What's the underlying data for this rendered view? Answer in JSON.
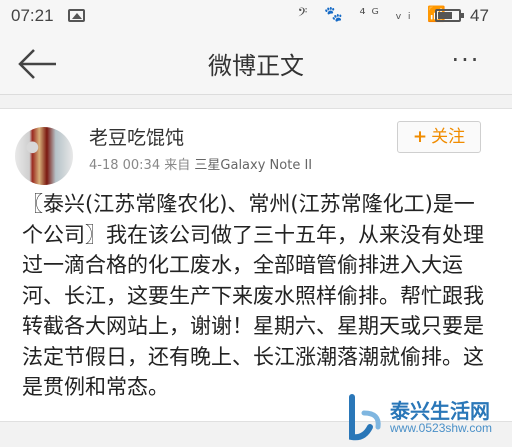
{
  "status_bar": {
    "time": "07:21",
    "right_icons": "𝄢 🐾 ⁴ᴳ ᵥᵢ 📶",
    "battery_percent": "47"
  },
  "nav": {
    "title": "微博正文",
    "more": "···"
  },
  "post": {
    "username": "老豆吃馄饨",
    "time": "4-18 00:34",
    "source_prefix": "来自",
    "source_device": "三星Galaxy Note II",
    "follow_label": "关注",
    "follow_plus": "+",
    "content": "〖泰兴(江苏常隆农化)、常州(江苏常隆化工)是一个公司〗我在该公司做了三十五年，从来没有处理过一滴合格的化工废水，全部暗管偷排进入大运河、长江，这要生产下来废水照样偷排。帮忙跟我转截各大网站上，谢谢！星期六、星期天或只要是法定节假日，还有晚上、长江涨潮落潮就偷排。这是贯例和常态。"
  },
  "watermark": {
    "title": "泰兴生活网",
    "url": "www.0523shw.com"
  },
  "colors": {
    "follow_accent": "#f08c00",
    "watermark_blue": "#2a77b8"
  }
}
